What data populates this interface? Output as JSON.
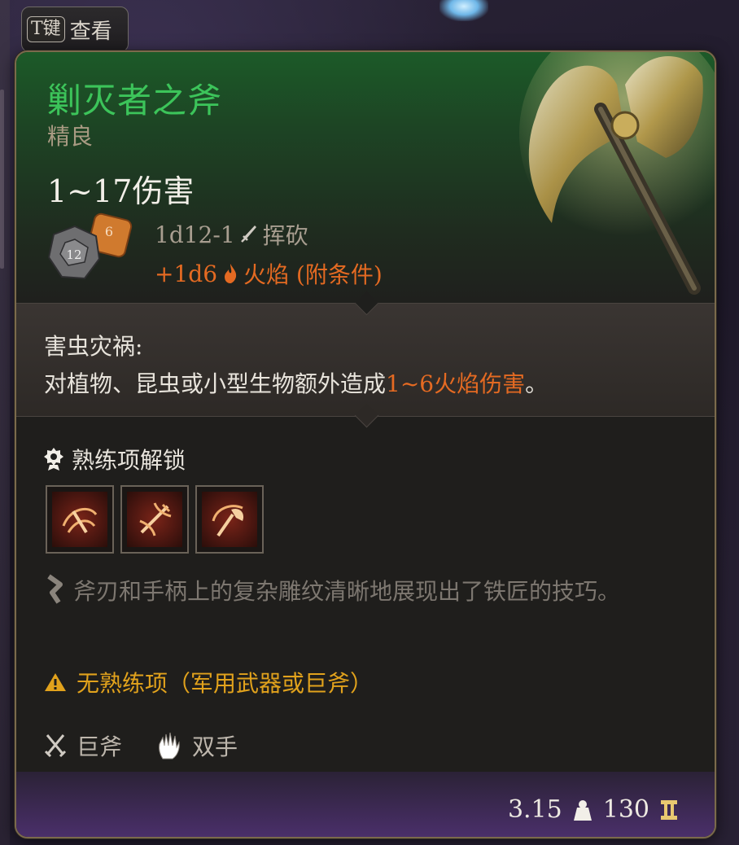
{
  "keyhint": {
    "key": "T键",
    "label": "查看"
  },
  "item": {
    "name": "剿灭者之斧",
    "rarity": "精良",
    "damage_range": "1~17伤害",
    "damage_dice": "1d12-1",
    "damage_type": "挥砍",
    "bonus_dice": "+1d6",
    "bonus_type": "火焰 (附条件)",
    "dice_icon_number": "12"
  },
  "passive": {
    "name": "害虫灾祸:",
    "desc_prefix": "对植物、昆虫或小型生物额外造成",
    "desc_highlight": "1~6火焰伤害",
    "desc_suffix": "。"
  },
  "proficiency": {
    "heading": "熟练项解锁",
    "actions": [
      "action-1",
      "action-2",
      "action-3"
    ]
  },
  "flavor_text": "斧刃和手柄上的复杂雕纹清晰地展现出了铁匠的技巧。",
  "warning": "无熟练项（军用武器或巨斧）",
  "properties": {
    "weapon_type": "巨斧",
    "handedness": "双手"
  },
  "stats": {
    "weight": "3.15",
    "value": "130"
  },
  "colors": {
    "title": "#3cc45a",
    "fire": "#e46a22",
    "warning": "#e1a21c"
  }
}
